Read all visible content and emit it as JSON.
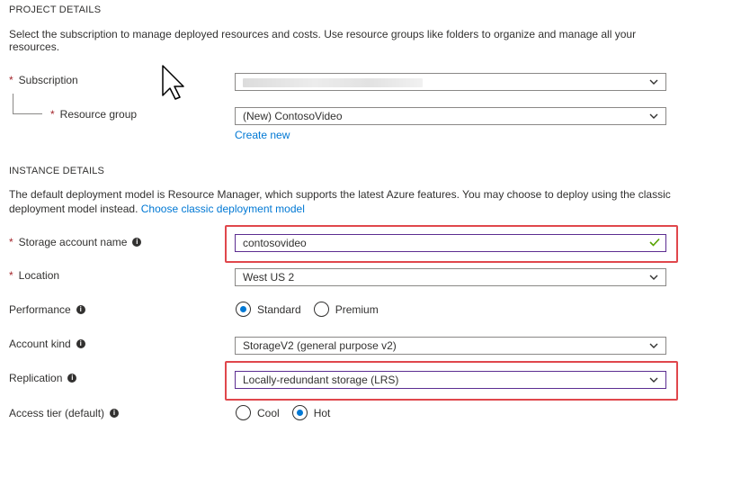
{
  "project_details": {
    "title": "PROJECT DETAILS",
    "description_line1": "Select the subscription to manage deployed resources and costs. Use resource groups like folders to organize and manage all your",
    "description_line2": "resources.",
    "subscription": {
      "required_mark": "*",
      "label": "Subscription"
    },
    "resource_group": {
      "required_mark": "*",
      "label": "Resource group",
      "value": "(New) ContosoVideo",
      "create_new": "Create new"
    }
  },
  "instance_details": {
    "title": "INSTANCE DETAILS",
    "description_line1": "The default deployment model is Resource Manager, which supports the latest Azure features. You may choose to deploy using the classic",
    "description_line2": "deployment model instead.",
    "classic_link": "Choose classic deployment model",
    "storage_account_name": {
      "required_mark": "*",
      "label": "Storage account name",
      "value": "contosovideo",
      "valid": true
    },
    "location": {
      "required_mark": "*",
      "label": "Location",
      "value": "West US 2"
    },
    "performance": {
      "label": "Performance",
      "options": [
        "Standard",
        "Premium"
      ],
      "selected": "Standard"
    },
    "account_kind": {
      "label": "Account kind",
      "value": "StorageV2 (general purpose v2)"
    },
    "replication": {
      "label": "Replication",
      "value": "Locally-redundant storage (LRS)"
    },
    "access_tier": {
      "label": "Access tier (default)",
      "options": [
        "Cool",
        "Hot"
      ],
      "selected": "Hot"
    }
  },
  "icons": {
    "info": "info-icon",
    "dropdown": "chevron-down-icon",
    "valid": "checkmark-icon",
    "cursor": "mouse-pointer-icon"
  },
  "colors": {
    "required": "#a4262c",
    "link": "#0078d4",
    "valid_check": "#57a300",
    "highlight_box": "#e0474c",
    "focused_border": "#5c2d91"
  }
}
